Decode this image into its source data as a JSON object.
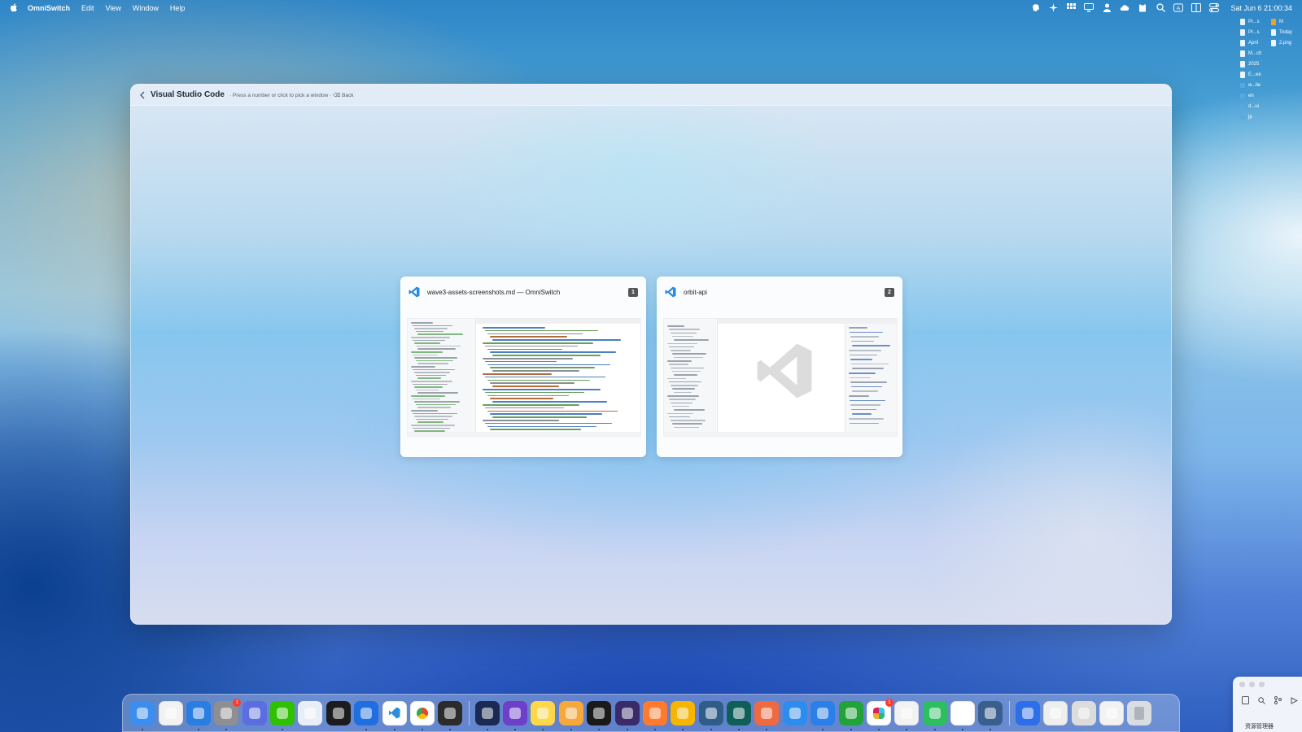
{
  "menubar": {
    "app_name": "OmniSwitch",
    "items": [
      "Edit",
      "View",
      "Window",
      "Help"
    ],
    "clock": "Sat Jun 6  21:00:34",
    "status_icons": [
      "evernote-icon",
      "sparkle-icon",
      "grid-icon",
      "display-icon",
      "person-icon",
      "cloud-icon",
      "clipboard-icon",
      "search-icon",
      "input-source-icon",
      "window-icon",
      "control-center-icon"
    ]
  },
  "desktop_files": [
    {
      "name": "Pr...s",
      "kind": "file"
    },
    {
      "name": "M",
      "kind": "orange"
    },
    {
      "name": "Pr...s",
      "kind": "file"
    },
    {
      "name": "Today",
      "kind": "file"
    },
    {
      "name": "April",
      "kind": "file"
    },
    {
      "name": "2.png",
      "kind": "file"
    },
    {
      "name": "M...ch",
      "kind": "file"
    },
    {
      "name": "",
      "kind": "none"
    },
    {
      "name": "2025",
      "kind": "file"
    },
    {
      "name": "",
      "kind": "none"
    },
    {
      "name": "E...ee",
      "kind": "file"
    },
    {
      "name": "",
      "kind": "none"
    },
    {
      "name": "w...ile",
      "kind": "folder"
    },
    {
      "name": "",
      "kind": "none"
    },
    {
      "name": "en",
      "kind": "folder"
    },
    {
      "name": "",
      "kind": "none"
    },
    {
      "name": "d...ui",
      "kind": "folder"
    },
    {
      "name": "",
      "kind": "none"
    },
    {
      "name": "jp",
      "kind": "folder"
    },
    {
      "name": "",
      "kind": "none"
    }
  ],
  "switcher": {
    "title": "Visual Studio Code",
    "hint": "· Press a number or click to pick a window · ⌫ Back",
    "windows": [
      {
        "title": "wave3-assets-screenshots.md — OmniSwitch",
        "number": "1"
      },
      {
        "title": "orbit-api",
        "number": "2"
      }
    ]
  },
  "dock": {
    "apps": [
      {
        "name": "finder",
        "color": "#3b8df0",
        "running": true
      },
      {
        "name": "launchpad",
        "color": "#f2f2f2",
        "running": false
      },
      {
        "name": "safari",
        "color": "#2a7de1",
        "running": true
      },
      {
        "name": "system-settings",
        "color": "#8e8e93",
        "running": true,
        "badge": "1"
      },
      {
        "name": "simulator",
        "color": "#5b6ee1",
        "running": false
      },
      {
        "name": "wechat",
        "color": "#2dc100",
        "running": true
      },
      {
        "name": "preview",
        "color": "#e8eef6",
        "running": false
      },
      {
        "name": "dice-app",
        "color": "#1c1c1e",
        "running": false
      },
      {
        "name": "xcode",
        "color": "#1f6fe0",
        "running": true
      },
      {
        "name": "vscode",
        "color": "#ffffff",
        "running": true
      },
      {
        "name": "chrome",
        "color": "#ffffff",
        "running": true
      },
      {
        "name": "terminal-window",
        "color": "#2b2b2b",
        "running": true
      },
      {
        "separator": true
      },
      {
        "name": "warp",
        "color": "#1b2a52",
        "running": true
      },
      {
        "name": "github-desktop",
        "color": "#6e40c9",
        "running": true
      },
      {
        "name": "notes",
        "color": "#ffd84a",
        "running": true
      },
      {
        "name": "tableplus",
        "color": "#f4a93a",
        "running": true
      },
      {
        "name": "datagrip",
        "color": "#1a1a1a",
        "running": true
      },
      {
        "name": "claude-orb",
        "color": "#3a2a6a",
        "running": true
      },
      {
        "name": "pencil",
        "color": "#ff7a2e",
        "running": true
      },
      {
        "name": "lemon",
        "color": "#f7b500",
        "running": true
      },
      {
        "name": "layers",
        "color": "#2f5d8a",
        "running": true
      },
      {
        "name": "cursor-arrow",
        "color": "#0e5f58",
        "running": true
      },
      {
        "name": "claude",
        "color": "#f06a3f",
        "running": true
      },
      {
        "name": "app-store",
        "color": "#2d8cf0",
        "running": false
      },
      {
        "name": "keynote",
        "color": "#2b7fe8",
        "running": true
      },
      {
        "name": "numbers",
        "color": "#22a33a",
        "running": true
      },
      {
        "name": "slack",
        "color": "#ffffff",
        "running": true,
        "badge": "1"
      },
      {
        "name": "kaleidoscope",
        "color": "#f2f2f2",
        "running": true
      },
      {
        "name": "evernote",
        "color": "#2dbe60",
        "running": true
      },
      {
        "name": "mosaic",
        "color": "#ffffff",
        "running": true
      },
      {
        "name": "siri-app",
        "color": "#3a5f8f",
        "running": true
      },
      {
        "separator": true
      },
      {
        "name": "minimized-window-1",
        "color": "#2d6fe8",
        "running": false
      },
      {
        "name": "minimized-window-2",
        "color": "#eeeeee",
        "running": false
      },
      {
        "name": "minimized-window-3",
        "color": "#dcdcdc",
        "running": false
      },
      {
        "name": "minimized-window-4",
        "color": "#f2f2f2",
        "running": false
      },
      {
        "name": "trash",
        "color": "#d9dde2",
        "running": false
      }
    ]
  },
  "finder_mini": {
    "label": "资源管理器"
  }
}
